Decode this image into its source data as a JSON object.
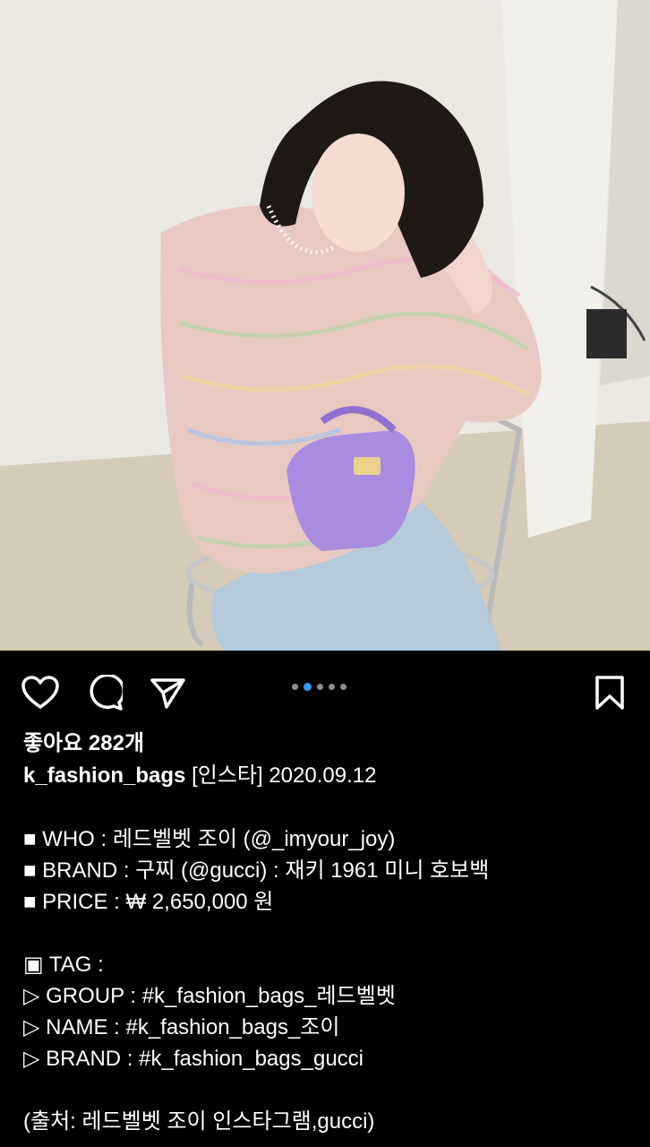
{
  "post": {
    "image": {
      "description_icon": "photo-post-image"
    },
    "actions": {
      "like_icon": "heart-icon",
      "comment_icon": "comment-icon",
      "share_icon": "send-icon",
      "save_icon": "bookmark-icon"
    },
    "carousel": {
      "total": 5,
      "active_index": 1,
      "active_color": "#3897f0",
      "inactive_color": "#8e8e8e"
    },
    "likes_text": "좋아요 282개",
    "username": "k_fashion_bags",
    "caption_title": " [인스타] 2020.09.12",
    "details": [
      "■ WHO : 레드벨벳 조이 (@_imyour_joy)",
      "■ BRAND : 구찌 (@gucci) : 재키 1961 미니 호보백",
      "■ PRICE : ₩ 2,650,000 원"
    ],
    "tags": [
      "▣ TAG :",
      "▷ GROUP : #k_fashion_bags_레드벨벳",
      "▷ NAME : #k_fashion_bags_조이",
      "▷ BRAND : #k_fashion_bags_gucci"
    ],
    "source": "(출처: 레드벨벳 조이 인스타그램,gucci)"
  }
}
